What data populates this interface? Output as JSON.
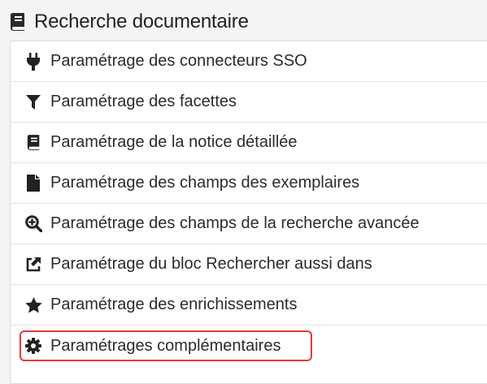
{
  "header": {
    "title": "Recherche documentaire",
    "icon": "book-icon"
  },
  "items": [
    {
      "label": "Paramétrage des connecteurs SSO",
      "icon": "plug-icon"
    },
    {
      "label": "Paramétrage des facettes",
      "icon": "filter-icon"
    },
    {
      "label": "Paramétrage de la notice détaillée",
      "icon": "book-icon"
    },
    {
      "label": "Paramétrage des champs des exemplaires",
      "icon": "file-icon"
    },
    {
      "label": "Paramétrage des champs de la recherche avancée",
      "icon": "search-plus-icon"
    },
    {
      "label": "Paramétrage du bloc Rechercher aussi dans",
      "icon": "external-link-icon"
    },
    {
      "label": "Paramétrage des enrichissements",
      "icon": "star-icon"
    },
    {
      "label": "Paramétrages complémentaires",
      "icon": "gear-icon",
      "highlighted": true
    }
  ],
  "colors": {
    "highlight_border": "#e03a3a",
    "icon": "#222222",
    "background": "#f4f4f4"
  }
}
